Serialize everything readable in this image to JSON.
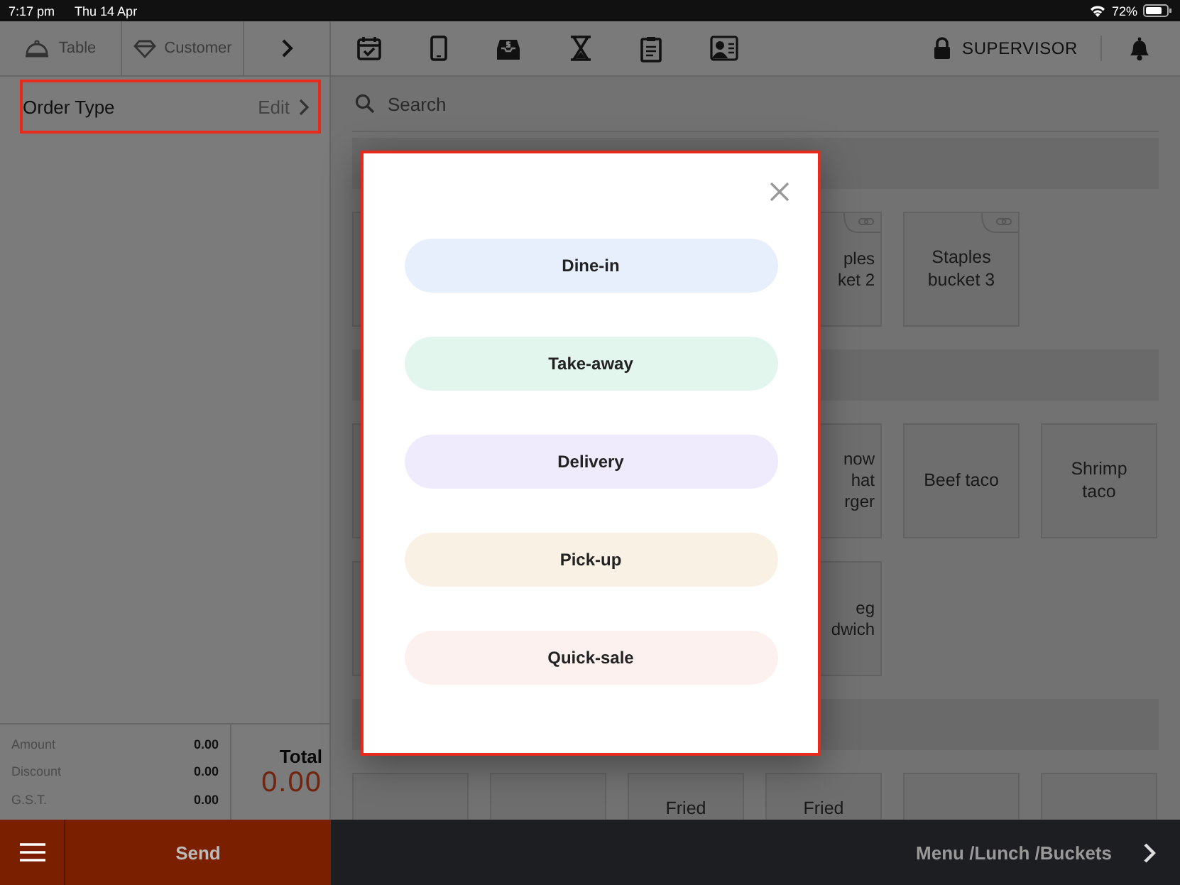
{
  "status_bar": {
    "time": "7:17 pm",
    "date": "Thu 14 Apr",
    "battery": "72%"
  },
  "left_tabs": [
    {
      "label": "Table"
    },
    {
      "label": "Customer"
    }
  ],
  "order_type": {
    "label": "Order Type",
    "action": "Edit"
  },
  "toolbar": {
    "role": "SUPERVISOR"
  },
  "search": {
    "placeholder": "Search"
  },
  "grid": [
    {
      "kind": "category"
    },
    {
      "kind": "row",
      "tiles": [
        {
          "kind": "tile"
        },
        {
          "kind": "gap"
        },
        {
          "kind": "gap"
        },
        {
          "kind": "cut_tile",
          "label": "ples\nket 2",
          "linked": true
        },
        {
          "kind": "tile",
          "label": "Staples\nbucket  3",
          "linked": true
        }
      ]
    },
    {
      "kind": "category"
    },
    {
      "kind": "row",
      "tiles": [
        {
          "kind": "tile"
        },
        {
          "kind": "gap"
        },
        {
          "kind": "gap"
        },
        {
          "kind": "cut_tile",
          "label": "now\nhat\nrger"
        },
        {
          "kind": "tile",
          "label": "Beef  taco"
        },
        {
          "kind": "tile",
          "label": "Shrimp\ntaco"
        }
      ]
    },
    {
      "kind": "row",
      "tiles": [
        {
          "kind": "tile"
        },
        {
          "kind": "gap"
        },
        {
          "kind": "gap"
        },
        {
          "kind": "cut_tile",
          "label": "eg\ndwich"
        }
      ]
    },
    {
      "kind": "category"
    },
    {
      "kind": "cut_row",
      "tiles": [
        {
          "kind": "tile"
        },
        {
          "kind": "tile"
        },
        {
          "kind": "tile",
          "label": "Fried"
        },
        {
          "kind": "tile",
          "label": "Fried"
        },
        {
          "kind": "tile"
        },
        {
          "kind": "tile"
        }
      ]
    }
  ],
  "totals": [
    {
      "label": "Amount",
      "value": "0.00"
    },
    {
      "label": "Discount",
      "value": "0.00"
    },
    {
      "label": "G.S.T.",
      "value": "0.00"
    }
  ],
  "total": {
    "label": "Total",
    "value": "0.00"
  },
  "bottom_bar": {
    "send": "Send",
    "breadcrumb": "Menu /Lunch /Buckets"
  },
  "dialog": {
    "options": [
      {
        "label": "Dine-in",
        "color": "#e8effc"
      },
      {
        "label": "Take-away",
        "color": "#e3f6ee"
      },
      {
        "label": "Delivery",
        "color": "#efebfc"
      },
      {
        "label": "Pick-up",
        "color": "#f9f1e4"
      },
      {
        "label": "Quick-sale",
        "color": "#fdf1ef"
      }
    ]
  }
}
